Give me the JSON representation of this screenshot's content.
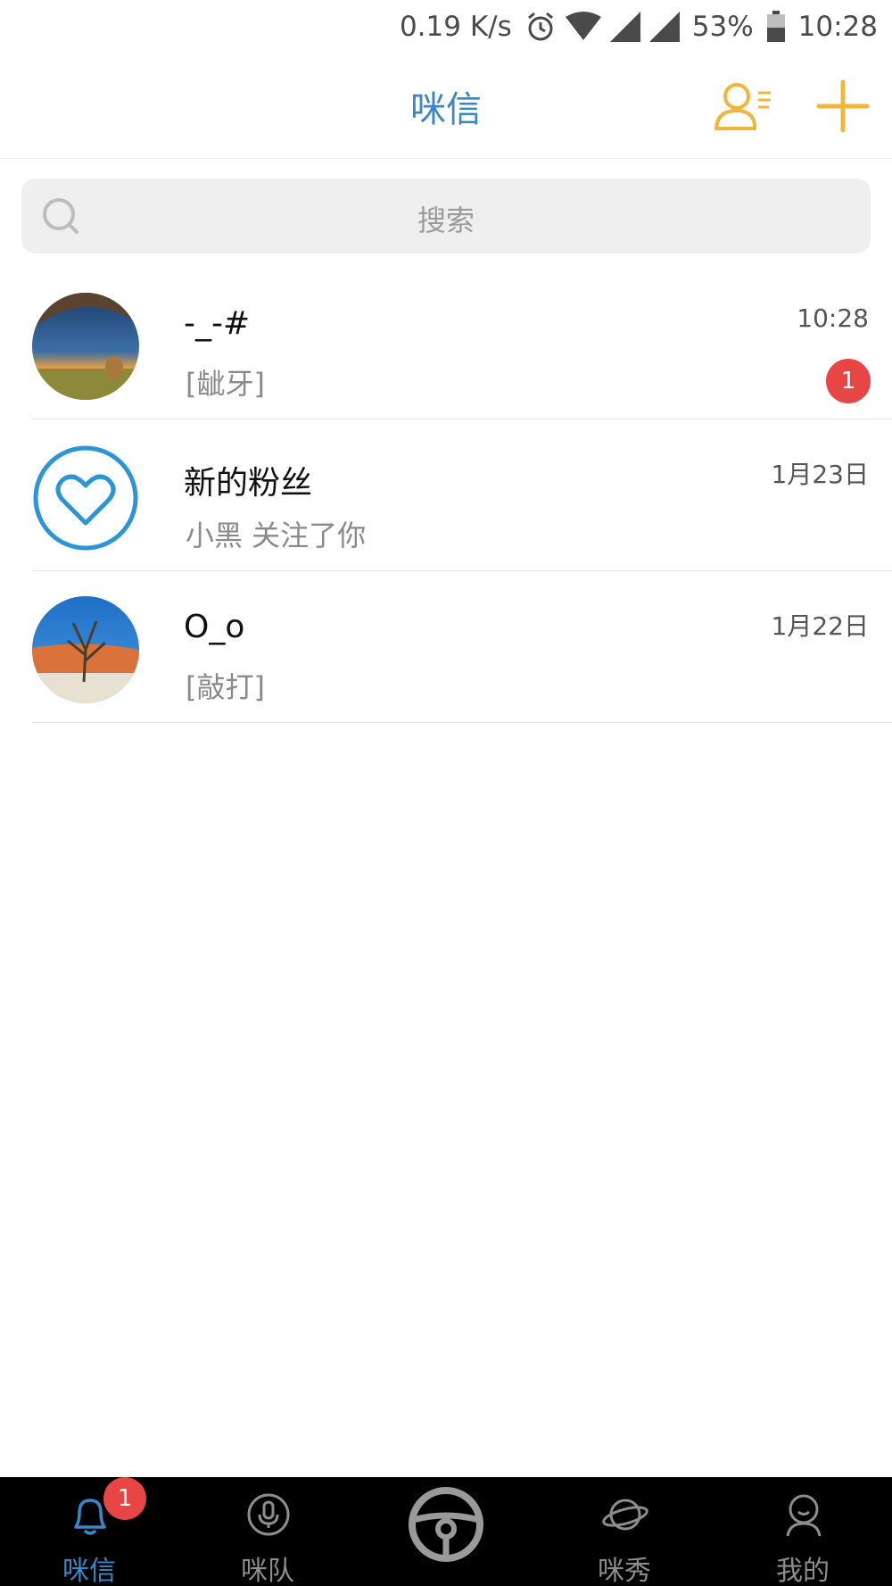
{
  "status_bar": {
    "net_speed": "0.19 K/s",
    "battery": "53%",
    "time": "10:28",
    "icons": [
      "alarm-icon",
      "wifi-icon",
      "signal-icon",
      "signal-icon",
      "battery-icon"
    ]
  },
  "header": {
    "title": "咪信",
    "actions": [
      "contacts-list-icon",
      "add-icon"
    ],
    "accent_color": "#f1b53a",
    "title_color": "#3a87c8"
  },
  "search": {
    "placeholder": "搜索"
  },
  "conversations": [
    {
      "name": "-_-#",
      "preview": "[龇牙]",
      "time": "10:28",
      "unread": "1",
      "avatar": "sunset-cave-photo"
    },
    {
      "name": "新的粉丝",
      "preview": "小黑 关注了你",
      "time": "1月23日",
      "avatar": "heart-icon"
    },
    {
      "name": "O_o",
      "preview": "[敲打]",
      "time": "1月22日",
      "avatar": "desert-tree-photo"
    }
  ],
  "tabbar": {
    "tabs": [
      {
        "label": "咪信",
        "icon": "bell-icon",
        "badge": "1",
        "active": true
      },
      {
        "label": "咪队",
        "icon": "microphone-icon"
      },
      {
        "label": "",
        "icon": "steering-wheel-icon"
      },
      {
        "label": "咪秀",
        "icon": "planet-icon"
      },
      {
        "label": "我的",
        "icon": "user-icon"
      }
    ],
    "active_color": "#3a87c8",
    "badge_color": "#e84545"
  }
}
